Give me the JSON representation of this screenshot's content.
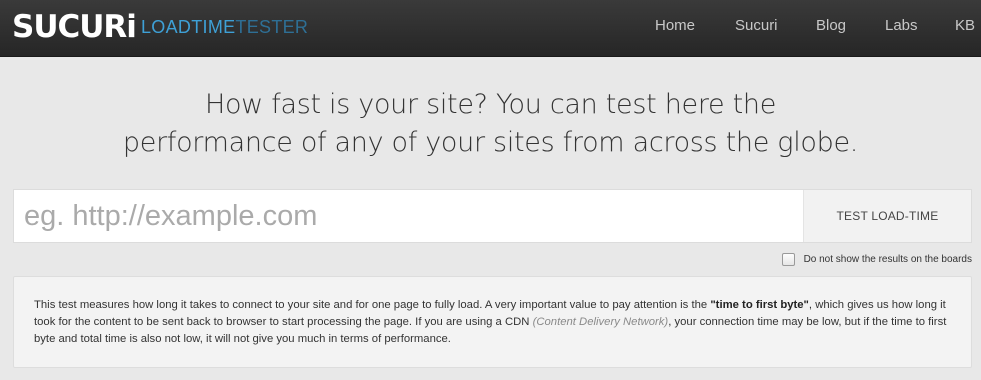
{
  "header": {
    "logo_text": "SUCURI",
    "product_part1": "LOADTIME",
    "product_part2": "TESTER",
    "nav": [
      {
        "label": "Home"
      },
      {
        "label": "Sucuri"
      },
      {
        "label": "Blog"
      },
      {
        "label": "Labs"
      },
      {
        "label": "KB"
      }
    ]
  },
  "hero": {
    "line1": "How fast is your site? You can test here the",
    "line2": "performance of any of your sites from across the globe."
  },
  "search": {
    "placeholder": "eg. http://example.com",
    "value": "",
    "button_label": "TEST LOAD-TIME"
  },
  "option": {
    "checked": false,
    "label": "Do not show the results on the boards"
  },
  "info": {
    "text_1": "This test measures how long it takes to connect to your site and for one page to fully load. A very important value to pay attention is the ",
    "bold": "\"time to first byte\"",
    "text_2": ", which gives us how long it took for the content to be sent back to browser to start processing the page. If you are using a CDN ",
    "italic": "(Content Delivery Network)",
    "text_3": ", your connection time may be low, but if the time to first byte and total time is also not low, it will not give you much in terms of performance."
  },
  "colors": {
    "topbar": "#2f2f2f",
    "brand_blue": "#3ea0d6",
    "brand_dark_blue": "#2e6f95",
    "page_bg": "#e8e8e8"
  }
}
